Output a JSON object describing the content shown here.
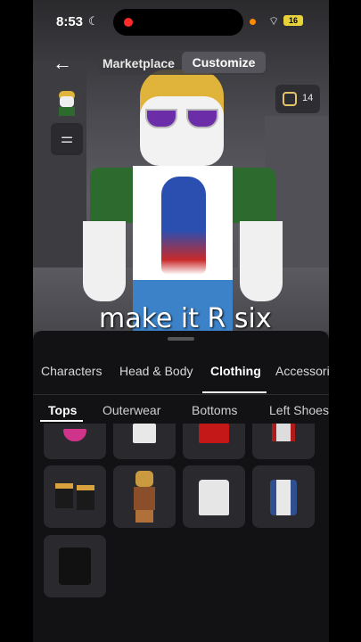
{
  "status_bar": {
    "time": "8:53",
    "moon": "☾",
    "wifi": "⌔",
    "battery": "16"
  },
  "header": {
    "back_icon": "←",
    "tabs": [
      "Marketplace",
      "Customize"
    ],
    "active_tab": "Customize"
  },
  "robux": {
    "balance": "14"
  },
  "filter_icon": "⚌",
  "caption": "make it R six",
  "categories": [
    "Characters",
    "Head & Body",
    "Clothing",
    "Accessories"
  ],
  "active_category": "Clothing",
  "subcategories": [
    "Tops",
    "Outerwear",
    "Bottoms",
    "Left Shoes"
  ],
  "active_subcategory": "Tops",
  "colors": {
    "accent": "#ffffff",
    "sheet": "#121215",
    "tile": "#2a2a2e",
    "robux_gold": "#e4c36a"
  }
}
